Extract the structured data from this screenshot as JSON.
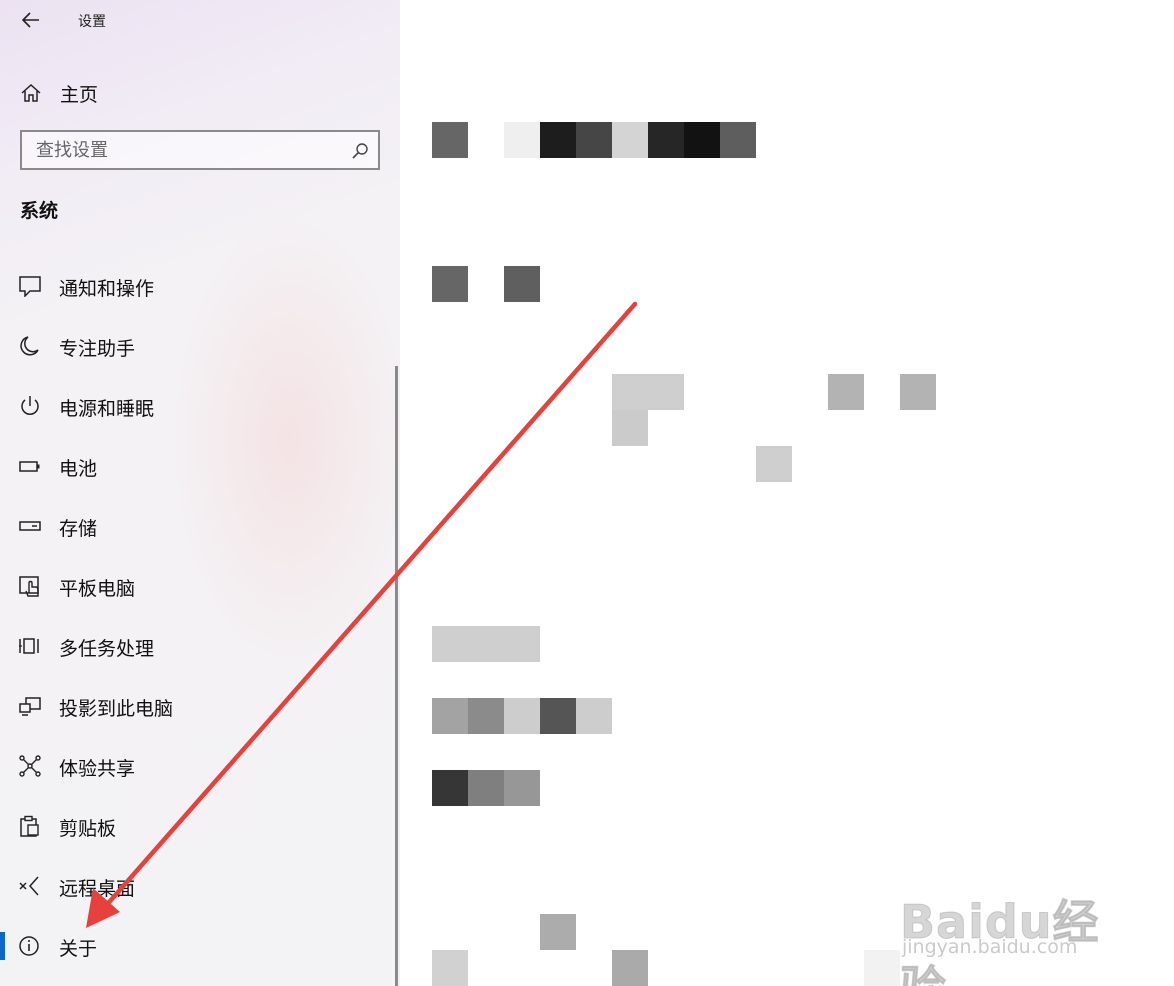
{
  "window": {
    "title": "设置",
    "back_icon": "back-arrow-icon"
  },
  "sidebar": {
    "home_label": "主页",
    "search": {
      "placeholder": "查找设置"
    },
    "section_title": "系统",
    "items": [
      {
        "label": "通知和操作",
        "icon": "notification-icon"
      },
      {
        "label": "专注助手",
        "icon": "moon-icon"
      },
      {
        "label": "电源和睡眠",
        "icon": "power-icon"
      },
      {
        "label": "电池",
        "icon": "battery-icon"
      },
      {
        "label": "存储",
        "icon": "storage-icon"
      },
      {
        "label": "平板电脑",
        "icon": "tablet-icon"
      },
      {
        "label": "多任务处理",
        "icon": "multitasking-icon"
      },
      {
        "label": "投影到此电脑",
        "icon": "projection-icon"
      },
      {
        "label": "体验共享",
        "icon": "shared-experiences-icon"
      },
      {
        "label": "剪贴板",
        "icon": "clipboard-icon"
      },
      {
        "label": "远程桌面",
        "icon": "remote-desktop-icon"
      },
      {
        "label": "关于",
        "icon": "info-icon",
        "selected": true
      }
    ]
  },
  "annotation": {
    "color": "#e8403a"
  },
  "watermark": {
    "logo": "Baidu经验",
    "url": "jingyan.baidu.com"
  },
  "colors": {
    "accent": "#0a66c8",
    "arrow": "#e8403a"
  }
}
